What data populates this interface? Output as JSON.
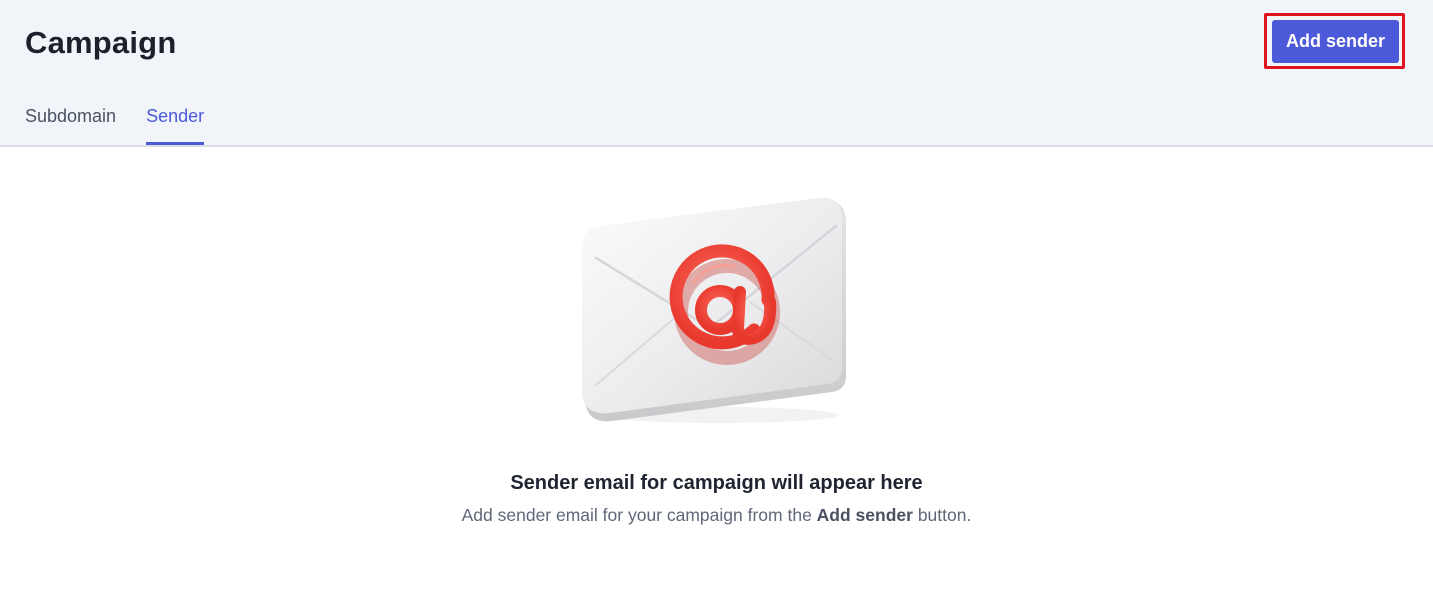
{
  "header": {
    "title": "Campaign",
    "add_sender_label": "Add sender"
  },
  "tabs": [
    {
      "label": "Subdomain",
      "active": false
    },
    {
      "label": "Sender",
      "active": true
    }
  ],
  "empty_state": {
    "illustration": "email-envelope-icon",
    "title": "Sender email for campaign will appear here",
    "subtitle_prefix": "Add sender email for your campaign from the",
    "subtitle_emphasis": "Add sender",
    "subtitle_suffix": "button."
  },
  "colors": {
    "accent": "#4c59d9",
    "highlight_frame": "#e0141e",
    "header_bg": "#f1f4f9",
    "at_symbol": "#f04a40"
  }
}
